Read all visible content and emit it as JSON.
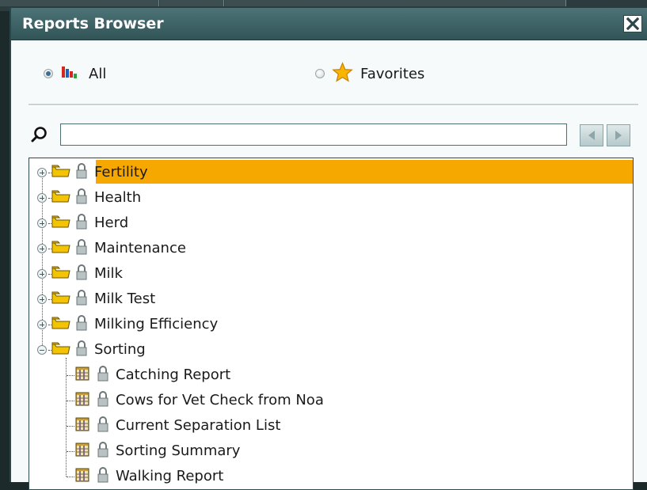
{
  "window": {
    "title": "Reports Browser"
  },
  "filters": {
    "all_label": "All",
    "favorites_label": "Favorites",
    "selected": "all"
  },
  "search": {
    "placeholder": "",
    "value": ""
  },
  "tree": {
    "folders": [
      {
        "label": "Fertility",
        "icon": "folder-icon",
        "expanded": false,
        "selected": true
      },
      {
        "label": "Health",
        "icon": "folder-icon",
        "expanded": false
      },
      {
        "label": "Herd",
        "icon": "folder-icon",
        "expanded": false
      },
      {
        "label": "Maintenance",
        "icon": "folder-icon",
        "expanded": false
      },
      {
        "label": "Milk",
        "icon": "folder-icon",
        "expanded": false
      },
      {
        "label": "Milk Test",
        "icon": "folder-icon",
        "expanded": false
      },
      {
        "label": "Milking Efficiency",
        "icon": "folder-icon",
        "expanded": false
      },
      {
        "label": "Sorting",
        "icon": "folder-icon",
        "expanded": true,
        "children": [
          {
            "label": "Catching Report",
            "icon": "report-icon"
          },
          {
            "label": "Cows for Vet Check from Noa",
            "icon": "report-icon"
          },
          {
            "label": "Current Separation List",
            "icon": "report-icon"
          },
          {
            "label": "Sorting Summary",
            "icon": "report-icon"
          },
          {
            "label": "Walking Report",
            "icon": "report-icon"
          }
        ]
      }
    ]
  },
  "colors": {
    "titlebar": "#315457",
    "selection": "#f7a800",
    "folder": "#f5c400"
  }
}
